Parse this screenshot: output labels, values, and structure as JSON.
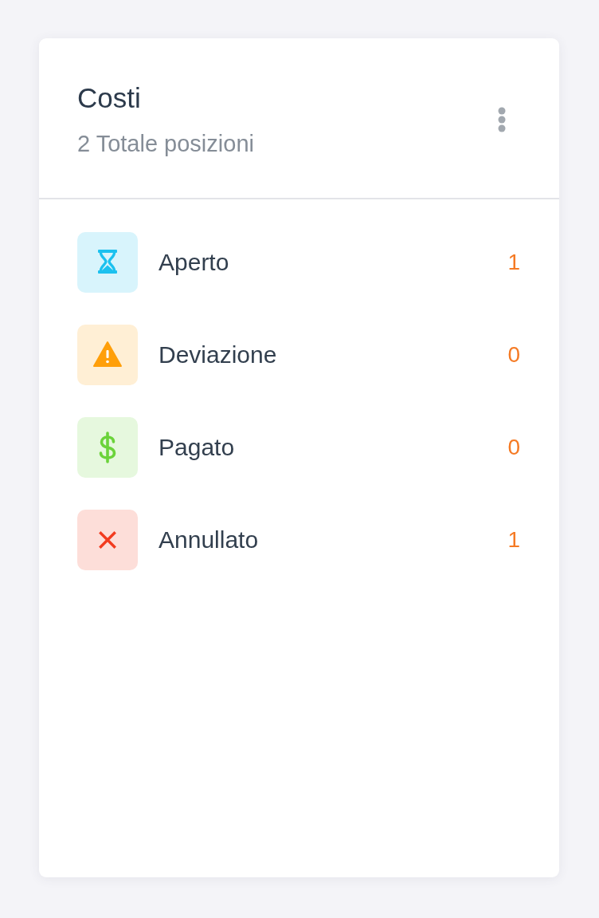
{
  "card": {
    "title": "Costi",
    "subtitle": "2 Totale posizioni"
  },
  "items": [
    {
      "kind": "hourglass",
      "label": "Aperto",
      "count": "1",
      "color": "#1cc1ef"
    },
    {
      "kind": "warning",
      "label": "Deviazione",
      "count": "0",
      "color": "#ff9f0a"
    },
    {
      "kind": "dollar",
      "label": "Pagato",
      "count": "0",
      "color": "#6bd33a"
    },
    {
      "kind": "cross",
      "label": "Annullato",
      "count": "1",
      "color": "#f23b1f"
    }
  ]
}
